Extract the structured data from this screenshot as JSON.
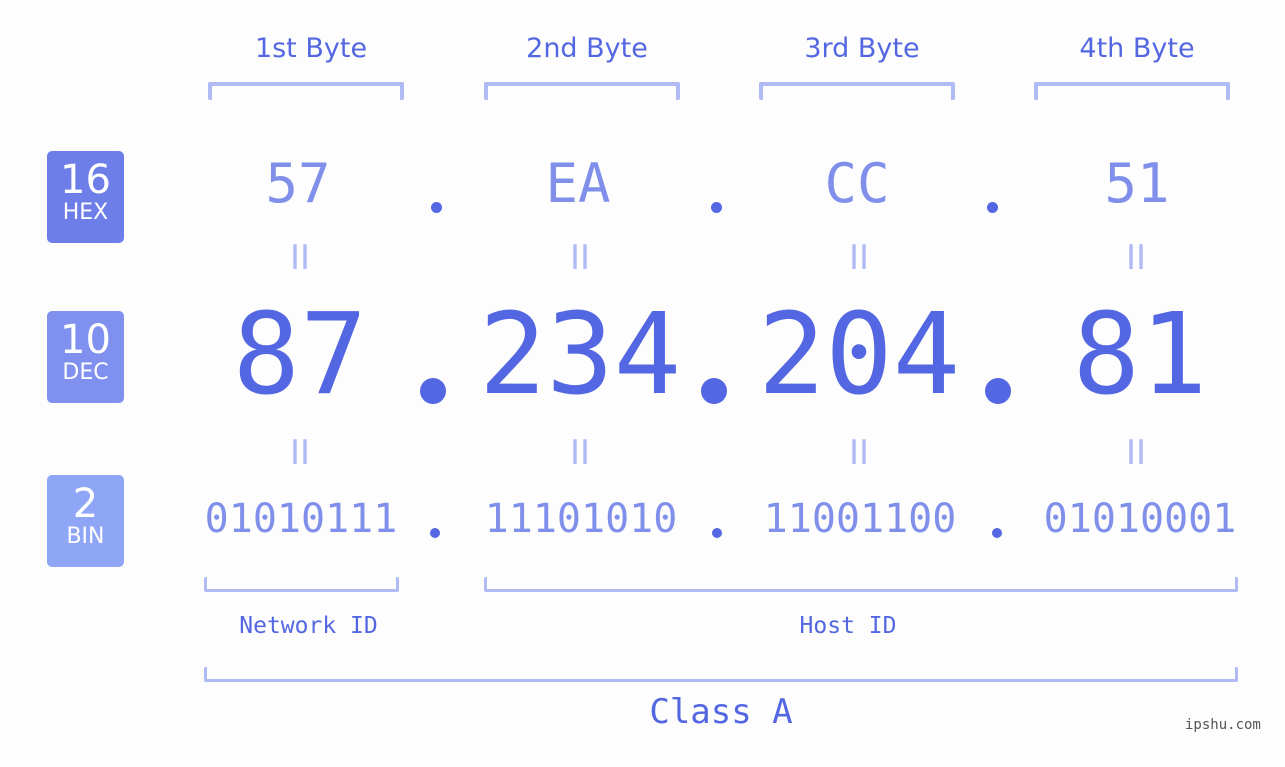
{
  "headers": [
    "1st Byte",
    "2nd Byte",
    "3rd Byte",
    "4th Byte"
  ],
  "badges": {
    "hex": {
      "num": "16",
      "label": "HEX",
      "color": "#6e7ee8"
    },
    "dec": {
      "num": "10",
      "label": "DEC",
      "color": "#8090ee"
    },
    "bin": {
      "num": "2",
      "label": "BIN",
      "color": "#8fa5f5"
    }
  },
  "hex": [
    "57",
    "EA",
    "CC",
    "51"
  ],
  "dec": [
    "87",
    "234",
    "204",
    "81"
  ],
  "bin": [
    "01010111",
    "11101010",
    "11001100",
    "01010001"
  ],
  "equals": "II",
  "labels": {
    "network": "Network ID",
    "host": "Host ID",
    "class": "Class A"
  },
  "watermark": "ipshu.com",
  "colors": {
    "primary": "#5467e2",
    "secondary": "#8090ea",
    "bracket": "#b0baf5"
  }
}
